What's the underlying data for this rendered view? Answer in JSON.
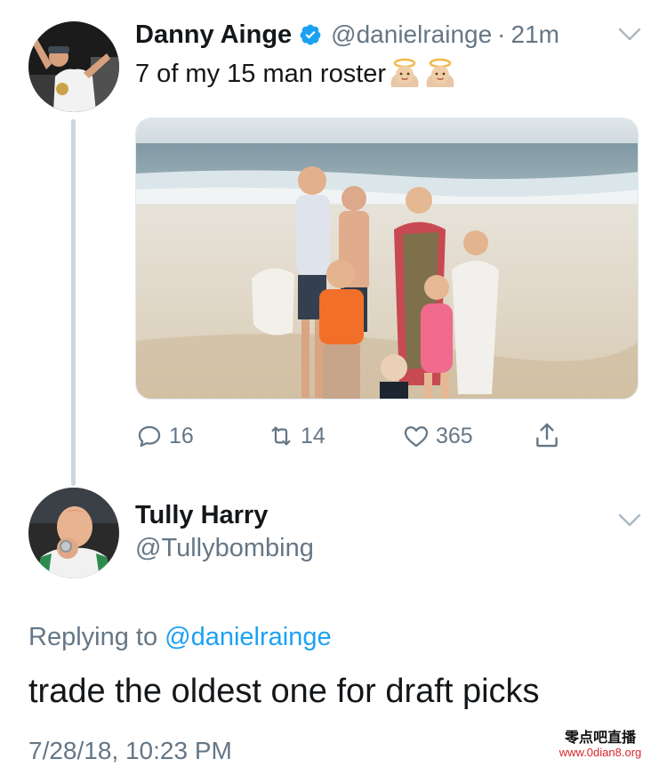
{
  "tweet": {
    "author_name": "Danny Ainge",
    "author_handle": "@danielrainge",
    "separator": "·",
    "time_ago": "21m",
    "text": "7 of my 15 man roster",
    "emoji_icons": [
      "baby-angel-emoji",
      "baby-angel-emoji"
    ],
    "actions": {
      "reply_count": "16",
      "retweet_count": "14",
      "like_count": "365"
    }
  },
  "reply": {
    "author_name": "Tully Harry",
    "author_handle": "@Tullybombing",
    "replying_to_label": "Replying to",
    "replying_to_handle": "@danielrainge",
    "text": "trade the oldest one for draft picks",
    "timestamp": "7/28/18, 10:23 PM"
  },
  "watermark": {
    "line1": "零点吧直播",
    "line2": "www.0dian8.org"
  },
  "colors": {
    "text_primary": "#14171a",
    "text_secondary": "#657786",
    "link": "#1da1f2",
    "verified": "#1da1f2",
    "thread_line": "#ccd6dd"
  },
  "icons": [
    "verified-badge-icon",
    "chevron-down-icon",
    "reply-icon",
    "retweet-icon",
    "like-icon",
    "share-icon"
  ]
}
